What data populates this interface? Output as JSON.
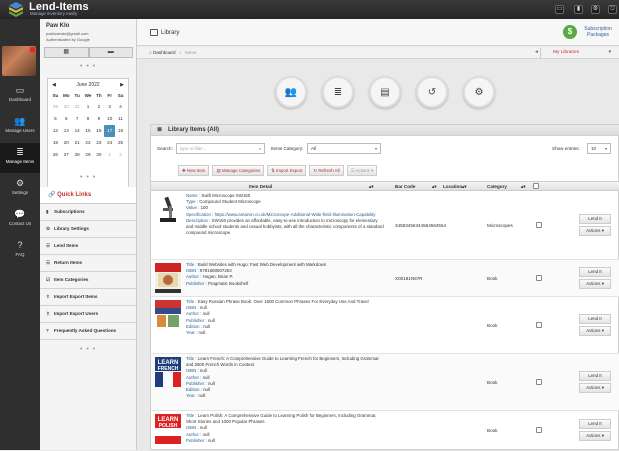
{
  "app": {
    "brand": "Lend-Items",
    "tagline": "Manage inventory easily"
  },
  "topbar_icons": [
    "monitor-icon",
    "bookmark-icon",
    "gear-icon",
    "exit-icon"
  ],
  "leftnav": [
    {
      "label": "Dashboard",
      "icon": "monitor-icon"
    },
    {
      "label": "Manage Users",
      "icon": "users-icon"
    },
    {
      "label": "Manage Items",
      "icon": "stack-icon"
    },
    {
      "label": "Settings",
      "icon": "gear-icon"
    },
    {
      "label": "Contact Us",
      "icon": "chat-icon"
    },
    {
      "label": "FAQ",
      "icon": "question-icon"
    }
  ],
  "user": {
    "name": "Paw Klo",
    "email": "pwklosinski@gmail.com",
    "auth": "Authenticated by Google"
  },
  "calendar": {
    "month": "June 2022",
    "weekdays": [
      "Su",
      "Mo",
      "Tu",
      "We",
      "Th",
      "Fr",
      "Sa"
    ],
    "days": [
      {
        "d": "29",
        "out": true
      },
      {
        "d": "30",
        "out": true
      },
      {
        "d": "31",
        "out": true
      },
      {
        "d": "1"
      },
      {
        "d": "2"
      },
      {
        "d": "3"
      },
      {
        "d": "4"
      },
      {
        "d": "5"
      },
      {
        "d": "6"
      },
      {
        "d": "7"
      },
      {
        "d": "8"
      },
      {
        "d": "9"
      },
      {
        "d": "10"
      },
      {
        "d": "11"
      },
      {
        "d": "12"
      },
      {
        "d": "13"
      },
      {
        "d": "14"
      },
      {
        "d": "15"
      },
      {
        "d": "16"
      },
      {
        "d": "17",
        "today": true
      },
      {
        "d": "18"
      },
      {
        "d": "19"
      },
      {
        "d": "20"
      },
      {
        "d": "21"
      },
      {
        "d": "22"
      },
      {
        "d": "23"
      },
      {
        "d": "24"
      },
      {
        "d": "25"
      },
      {
        "d": "26"
      },
      {
        "d": "27"
      },
      {
        "d": "28"
      },
      {
        "d": "29"
      },
      {
        "d": "30"
      },
      {
        "d": "1",
        "out": true
      },
      {
        "d": "2",
        "out": true
      }
    ]
  },
  "quicklinks": {
    "title": "Quick Links",
    "items": [
      "Subscriptions",
      "Library Settings",
      "Lend Items",
      "Return Items",
      "Item Categories",
      "Import Export Items",
      "Import Export Users",
      "Frequently Asked Questions"
    ]
  },
  "page": {
    "title": "Library",
    "subscription": "Subscription Packages",
    "breadcrumb_home": "Dashboard",
    "breadcrumb_sep": "›",
    "breadcrumb_current": "Items",
    "my_libraries": "My Libraries"
  },
  "panel": {
    "title": "Library Items (All)",
    "search_label": "Search:",
    "search_placeholder": "type to filter...",
    "category_label": "Items Category:",
    "category_value": "All",
    "show_label": "Show entries:",
    "show_value": "10",
    "buttons": [
      "New Item",
      "Manage Categories",
      "Import Export",
      "Refresh All",
      "Actions"
    ],
    "columns": [
      "Item Detail",
      "Bar Code",
      "Location",
      "Category"
    ]
  },
  "items": [
    {
      "thumb": "microscope",
      "fields": [
        {
          "k": "Name",
          "v": "Swift Microscope SW150"
        },
        {
          "k": "Type",
          "v": "Compound Student Microscope"
        },
        {
          "k": "Value",
          "v": "100"
        },
        {
          "k": "Specification",
          "v": "https://www.amazon.co.uk/Microscope-Additional-Wide-field-Illumination-Capability",
          "link": true
        },
        {
          "k": "Description",
          "v": "SW150 provides an affordable, easy-to-use introduction to microscopy for elementary and middle school students and casual hobbyists, with all the characteristic components of a standard compound microscope"
        }
      ],
      "barcode": "34583456344564564554",
      "location": "",
      "category": "Microscopes",
      "lend": "Lend It",
      "actions": "Actions"
    },
    {
      "thumb": "hugo",
      "fields": [
        {
          "k": "Title",
          "v": "Build Websites with Hugo: Fast Web Development with Markdown"
        },
        {
          "k": "ISBN",
          "v": "9781680507263"
        },
        {
          "k": "Author",
          "v": "Hogan, Brian P."
        },
        {
          "k": "Publisher",
          "v": "Pragmatic Bookshelf"
        }
      ],
      "barcode": "X00181N87R",
      "location": "",
      "category": "Book",
      "lend": "Lend It",
      "actions": "Actions"
    },
    {
      "thumb": "russian",
      "fields": [
        {
          "k": "Title",
          "v": "Easy Russian Phrase Book: Over 1500 Common Phrases For Everyday Use And Travel"
        },
        {
          "k": "ISBN",
          "v": "null"
        },
        {
          "k": "Author",
          "v": "null"
        },
        {
          "k": "Publisher",
          "v": "null"
        },
        {
          "k": "Edition",
          "v": "null"
        },
        {
          "k": "Year",
          "v": "null"
        }
      ],
      "barcode": "",
      "location": "",
      "category": "Book",
      "lend": "Lend It",
      "actions": "Actions"
    },
    {
      "thumb": "french",
      "fields": [
        {
          "k": "Title",
          "v": "Learn French: A Comprehensive Guide to Learning French for Beginners, Including Grammar and 2500 French Words in Context"
        },
        {
          "k": "ISBN",
          "v": "null"
        },
        {
          "k": "Author",
          "v": "null"
        },
        {
          "k": "Publisher",
          "v": "null"
        },
        {
          "k": "Edition",
          "v": "null"
        },
        {
          "k": "Year",
          "v": "null"
        }
      ],
      "barcode": "",
      "location": "",
      "category": "Book",
      "lend": "Lend It",
      "actions": "Actions"
    },
    {
      "thumb": "polish",
      "fields": [
        {
          "k": "Title",
          "v": "Learn Polish: A Comprehensive Guide to Learning Polish for Beginners, Including Grammar, Short Stories and 1000 Popular Phrases"
        },
        {
          "k": "ISBN",
          "v": "null"
        },
        {
          "k": "Author",
          "v": "null"
        },
        {
          "k": "Publisher",
          "v": "null"
        }
      ],
      "barcode": "",
      "location": "",
      "category": "Book",
      "lend": "Lend It",
      "actions": "Actions"
    }
  ],
  "colors": {
    "topbar": "#2e2e2e",
    "accent_red": "#c9302c",
    "link": "#2a6496",
    "today": "#4a8fb7",
    "subscribe": "#5aa846"
  }
}
